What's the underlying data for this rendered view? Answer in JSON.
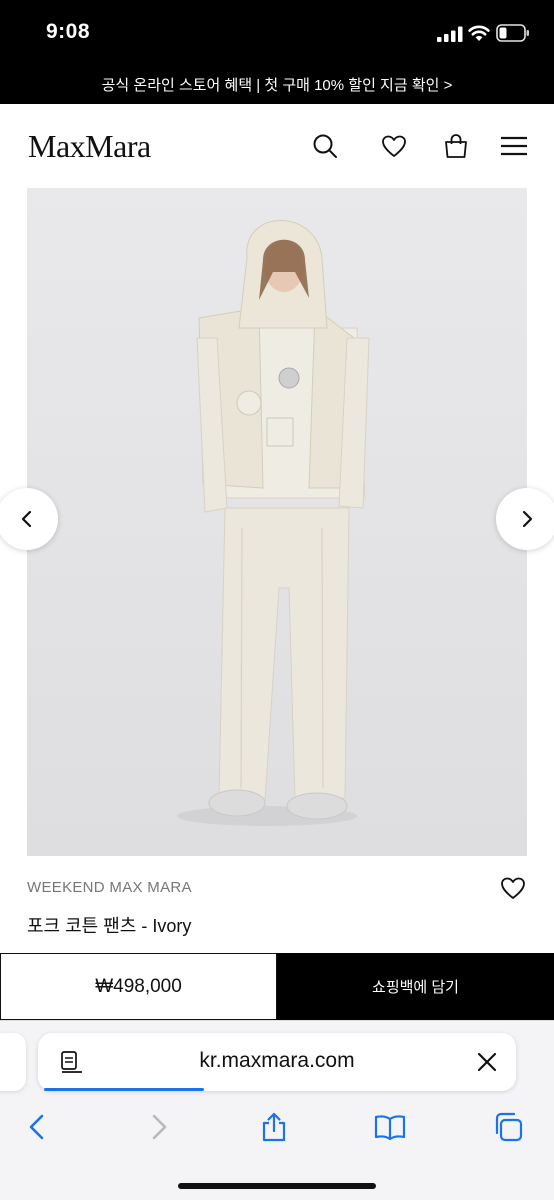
{
  "status_bar": {
    "time": "9:08"
  },
  "promo": {
    "text": "공식 온라인 스토어 혜택 | 첫 구매 10% 할인 지금 확인 >"
  },
  "header": {
    "logo": "MaxMara",
    "icons": [
      "search-icon",
      "heart-icon",
      "bag-icon",
      "menu-icon"
    ]
  },
  "product": {
    "brand": "WEEKEND MAX MARA",
    "name": "포크 코튼 팬츠 - Ivory",
    "price": "₩498,000",
    "add_to_cart": "쇼핑백에 담기"
  },
  "browser": {
    "url": "kr.maxmara.com",
    "accent": "#1a73e8",
    "toolbar": [
      "back-icon",
      "forward-icon",
      "share-icon",
      "bookmarks-icon",
      "tabs-icon"
    ]
  }
}
